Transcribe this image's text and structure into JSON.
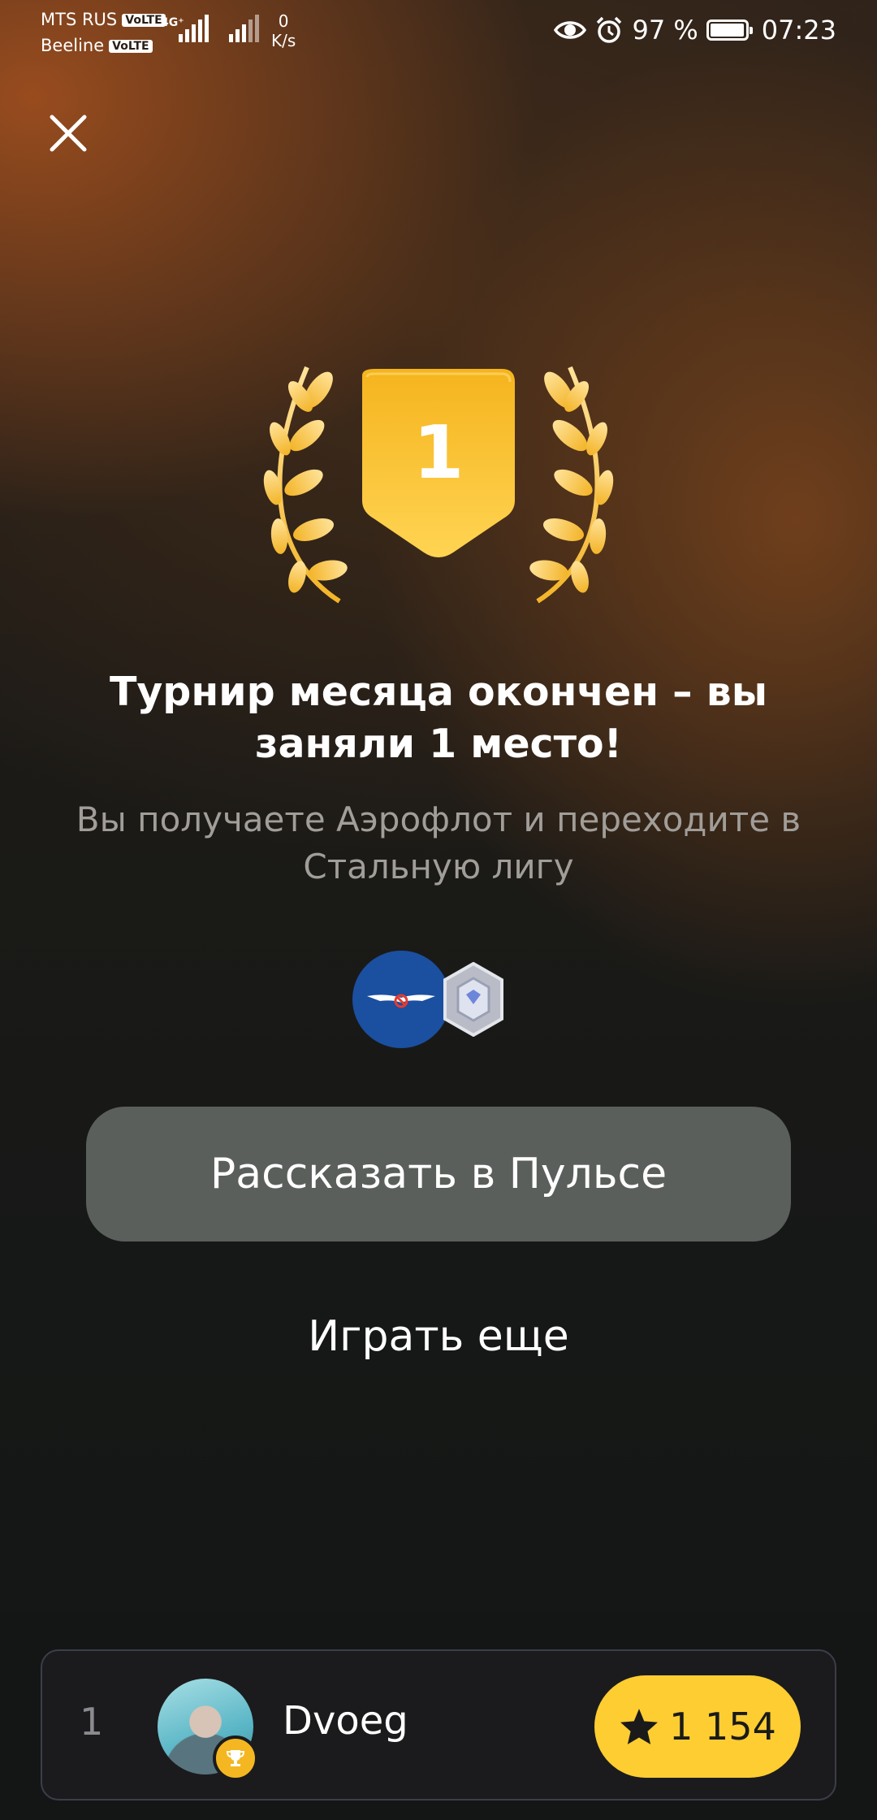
{
  "status_bar": {
    "carrier1": "MTS RUS",
    "carrier2": "Beeline",
    "volte": "VoLTE",
    "network": "4G⁺",
    "speed_value": "0",
    "speed_unit": "K/s",
    "battery": "97 %",
    "time": "07:23"
  },
  "badge": {
    "place": "1"
  },
  "result": {
    "title": "Турнир месяца окончен – вы заняли 1 место!",
    "subtitle": "Вы получаете Аэрофлот и переходите в Стальную лигу"
  },
  "actions": {
    "share_label": "Рассказать в Пульсе",
    "play_again_label": "Играть еще"
  },
  "leaderboard": {
    "rank": "1",
    "name": "Dvoeg",
    "score": "1 154"
  },
  "colors": {
    "gold": "#fecd31",
    "badge_gold": "#f5b41e",
    "share_button": "#5b5f5c",
    "aeroflot_blue": "#1b4fa0"
  },
  "icons": [
    "close-icon",
    "laurel-left-icon",
    "laurel-right-icon",
    "aeroflot-logo-icon",
    "steel-league-icon",
    "trophy-icon",
    "star-icon",
    "eye-icon",
    "alarm-icon",
    "battery-icon"
  ]
}
